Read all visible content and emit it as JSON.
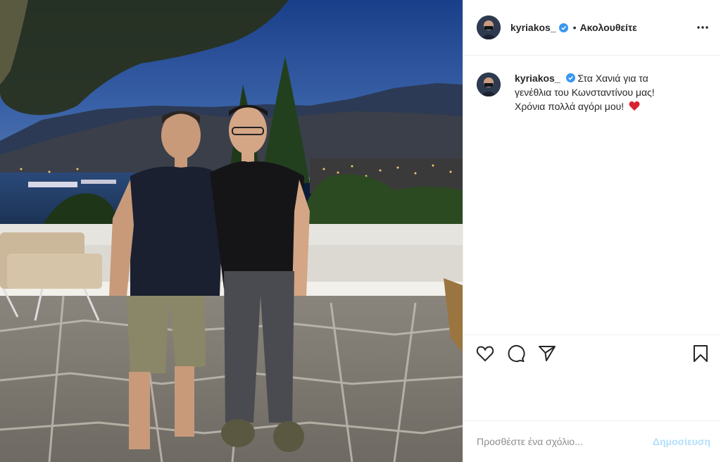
{
  "photo": {
    "alt_icon": "photo-image"
  },
  "header": {
    "username": "kyriakos_",
    "separator": "•",
    "follow_label": "Ακολουθείτε",
    "more_icon": "more-horizontal-icon",
    "verified_icon": "verified-badge-icon"
  },
  "caption": {
    "username": "kyriakos_",
    "text": "Στα Χανιά για τα γενέθλια του Κωνσταντίνου μας! Χρόνια πολλά αγόρι μου!",
    "emoji": "heart-emoji"
  },
  "actions": {
    "like_icon": "heart-icon",
    "comment_icon": "comment-icon",
    "share_icon": "share-icon",
    "save_icon": "bookmark-icon"
  },
  "comment": {
    "placeholder": "Προσθέστε ένα σχόλιο...",
    "post_label": "Δημοσίευση"
  },
  "colors": {
    "verified": "#3897f0",
    "post_disabled": "#b2dffc",
    "heart": "#d9232e",
    "divider": "#efefef"
  }
}
